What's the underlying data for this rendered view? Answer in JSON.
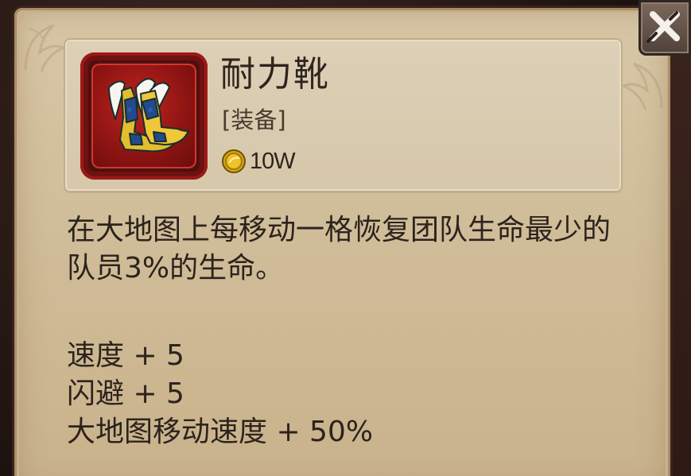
{
  "item": {
    "name": "耐力靴",
    "type": "[装备]",
    "price": "10W",
    "icon": "winged-boots-icon"
  },
  "description": "在大地图上每移动一格恢复团队生命最少的队员3%的生命。",
  "stats": [
    "速度 + 5",
    "闪避 + 5",
    "大地图移动速度 + 50%"
  ],
  "close_icon": "close-icon",
  "colors": {
    "parchment": "#d0bd99",
    "header": "#d8cab0",
    "frame_red": "#8f1513",
    "text": "#2d231d"
  }
}
